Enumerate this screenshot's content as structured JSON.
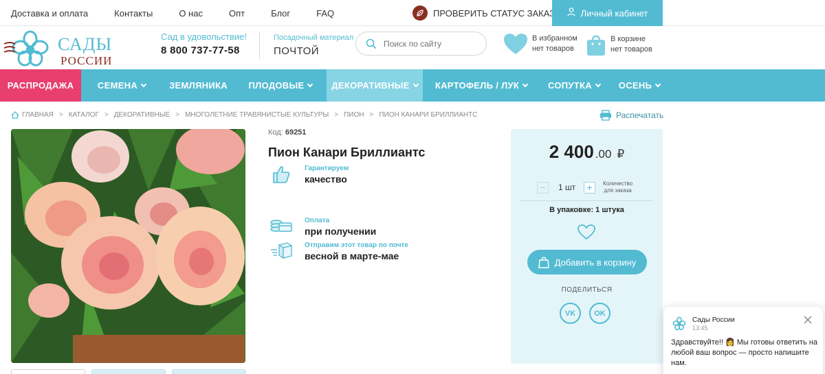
{
  "topbar": {
    "links": [
      "Доставка и оплата",
      "Контакты",
      "О нас",
      "Опт",
      "Блог",
      "FAQ"
    ],
    "status_label": "ПРОВЕРИТЬ СТАТУС ЗАКАЗА",
    "cabinet_label": "Личный кабинет"
  },
  "header": {
    "logo_line1": "САДЫ",
    "logo_line2": "РОССИИ",
    "phone_caption": "Сад в удовольствие!",
    "phone": "8 800 737-77-58",
    "plant_caption": "Посадочный материал",
    "plant_value": "ПОЧТОЙ",
    "search_placeholder": "Поиск по сайту",
    "favorites_line1": "В избранном",
    "favorites_line2": "нет товаров",
    "cart_line1": "В корзине",
    "cart_line2": "нет товаров"
  },
  "nav": {
    "items": [
      "РАСПРОДАЖА",
      "СЕМЕНА",
      "ЗЕМЛЯНИКА",
      "ПЛОДОВЫЕ",
      "ДЕКОРАТИВНЫЕ",
      "КАРТОФЕЛЬ / ЛУК",
      "СОПУТКА",
      "ОСЕНЬ"
    ]
  },
  "breadcrumbs": [
    "ГЛАВНАЯ",
    "КАТАЛОГ",
    "ДЕКОРАТИВНЫЕ",
    "МНОГОЛЕТНИЕ ТРАВЯНИСТЫЕ КУЛЬТУРЫ",
    "ПИОН",
    "ПИОН КАНАРИ БРИЛЛИАНТС"
  ],
  "print_label": "Распечатать",
  "product": {
    "code_label": "Код:",
    "code": "69251",
    "title": "Пион Канари Бриллиантс",
    "features": [
      {
        "caption": "Гарантируем",
        "value": "качество",
        "icon": "thumbs-up-icon"
      },
      {
        "caption": "Оплата",
        "value": "при получении",
        "icon": "money-icon"
      },
      {
        "caption": "Отправим этот товар по почте",
        "value": "весной в марте-мае",
        "icon": "parcel-icon"
      }
    ]
  },
  "buy": {
    "price_main": "2 400",
    "price_cents": ".00",
    "currency": "₽",
    "qty_value": "1 шт",
    "qty_note_line1": "Количество",
    "qty_note_line2": "для заказа",
    "pack": "В упаковке: 1 штука",
    "add_label": "Добавить в  корзину",
    "share_label": "ПОДЕЛИТЬСЯ",
    "vk": "VK",
    "ok": "OK"
  },
  "chat": {
    "name": "Сады России",
    "time": "13:45",
    "message": "Здравствуйте!! 👩 Мы готовы ответить на любой ваш вопрос — просто напишите нам."
  },
  "colors": {
    "accent": "#52bbd2",
    "sale": "#e83f6f",
    "active_nav": "#86d4e4",
    "brand_dark": "#8b2f23",
    "panel": "#e4f5f9"
  }
}
